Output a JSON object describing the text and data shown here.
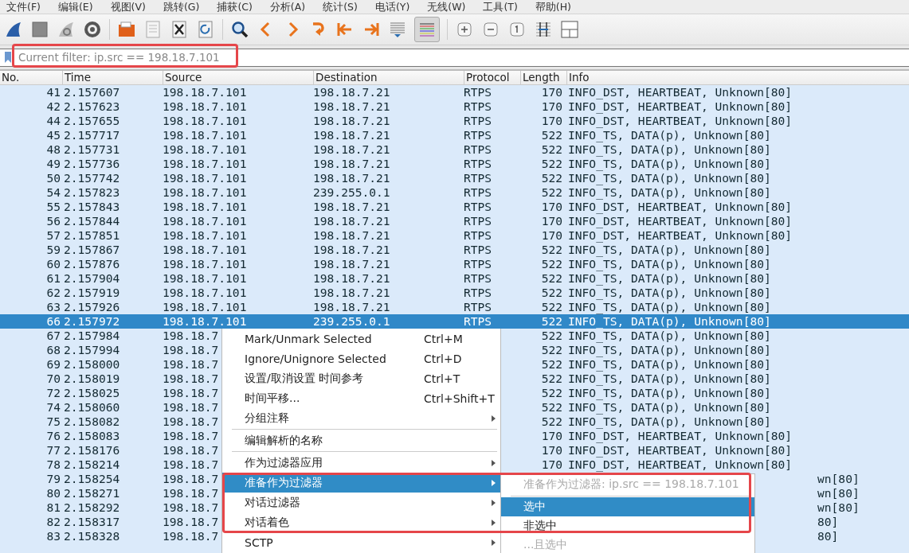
{
  "menubar": [
    "文件(F)",
    "编辑(E)",
    "视图(V)",
    "跳转(G)",
    "捕获(C)",
    "分析(A)",
    "统计(S)",
    "电话(Y)",
    "无线(W)",
    "工具(T)",
    "帮助(H)"
  ],
  "toolbar": {
    "colorize_pressed": true
  },
  "filter": {
    "placeholder": "Current filter: ip.src == 198.18.7.101"
  },
  "table": {
    "columns": [
      "No.",
      "Time",
      "Source",
      "Destination",
      "Protocol",
      "Length",
      "Info"
    ],
    "rows": [
      {
        "no": "41",
        "time": "2.157607",
        "source": "198.18.7.101",
        "destination": "198.18.7.21",
        "protocol": "RTPS",
        "length": "170",
        "info": "INFO_DST, HEARTBEAT, Unknown[80]",
        "selected": false
      },
      {
        "no": "42",
        "time": "2.157623",
        "source": "198.18.7.101",
        "destination": "198.18.7.21",
        "protocol": "RTPS",
        "length": "170",
        "info": "INFO_DST, HEARTBEAT, Unknown[80]",
        "selected": false
      },
      {
        "no": "44",
        "time": "2.157655",
        "source": "198.18.7.101",
        "destination": "198.18.7.21",
        "protocol": "RTPS",
        "length": "170",
        "info": "INFO_DST, HEARTBEAT, Unknown[80]",
        "selected": false
      },
      {
        "no": "45",
        "time": "2.157717",
        "source": "198.18.7.101",
        "destination": "198.18.7.21",
        "protocol": "RTPS",
        "length": "522",
        "info": "INFO_TS, DATA(p), Unknown[80]",
        "selected": false
      },
      {
        "no": "48",
        "time": "2.157731",
        "source": "198.18.7.101",
        "destination": "198.18.7.21",
        "protocol": "RTPS",
        "length": "522",
        "info": "INFO_TS, DATA(p), Unknown[80]",
        "selected": false
      },
      {
        "no": "49",
        "time": "2.157736",
        "source": "198.18.7.101",
        "destination": "198.18.7.21",
        "protocol": "RTPS",
        "length": "522",
        "info": "INFO_TS, DATA(p), Unknown[80]",
        "selected": false
      },
      {
        "no": "50",
        "time": "2.157742",
        "source": "198.18.7.101",
        "destination": "198.18.7.21",
        "protocol": "RTPS",
        "length": "522",
        "info": "INFO_TS, DATA(p), Unknown[80]",
        "selected": false
      },
      {
        "no": "54",
        "time": "2.157823",
        "source": "198.18.7.101",
        "destination": "239.255.0.1",
        "protocol": "RTPS",
        "length": "522",
        "info": "INFO_TS, DATA(p), Unknown[80]",
        "selected": false
      },
      {
        "no": "55",
        "time": "2.157843",
        "source": "198.18.7.101",
        "destination": "198.18.7.21",
        "protocol": "RTPS",
        "length": "170",
        "info": "INFO_DST, HEARTBEAT, Unknown[80]",
        "selected": false
      },
      {
        "no": "56",
        "time": "2.157844",
        "source": "198.18.7.101",
        "destination": "198.18.7.21",
        "protocol": "RTPS",
        "length": "170",
        "info": "INFO_DST, HEARTBEAT, Unknown[80]",
        "selected": false
      },
      {
        "no": "57",
        "time": "2.157851",
        "source": "198.18.7.101",
        "destination": "198.18.7.21",
        "protocol": "RTPS",
        "length": "170",
        "info": "INFO_DST, HEARTBEAT, Unknown[80]",
        "selected": false
      },
      {
        "no": "59",
        "time": "2.157867",
        "source": "198.18.7.101",
        "destination": "198.18.7.21",
        "protocol": "RTPS",
        "length": "522",
        "info": "INFO_TS, DATA(p), Unknown[80]",
        "selected": false
      },
      {
        "no": "60",
        "time": "2.157876",
        "source": "198.18.7.101",
        "destination": "198.18.7.21",
        "protocol": "RTPS",
        "length": "522",
        "info": "INFO_TS, DATA(p), Unknown[80]",
        "selected": false
      },
      {
        "no": "61",
        "time": "2.157904",
        "source": "198.18.7.101",
        "destination": "198.18.7.21",
        "protocol": "RTPS",
        "length": "522",
        "info": "INFO_TS, DATA(p), Unknown[80]",
        "selected": false
      },
      {
        "no": "62",
        "time": "2.157919",
        "source": "198.18.7.101",
        "destination": "198.18.7.21",
        "protocol": "RTPS",
        "length": "522",
        "info": "INFO_TS, DATA(p), Unknown[80]",
        "selected": false
      },
      {
        "no": "63",
        "time": "2.157926",
        "source": "198.18.7.101",
        "destination": "198.18.7.21",
        "protocol": "RTPS",
        "length": "522",
        "info": "INFO_TS, DATA(p), Unknown[80]",
        "selected": false
      },
      {
        "no": "66",
        "time": "2.157972",
        "source": "198.18.7.101",
        "destination": "239.255.0.1",
        "protocol": "RTPS",
        "length": "522",
        "info": "INFO_TS, DATA(p), Unknown[80]",
        "selected": true
      },
      {
        "no": "67",
        "time": "2.157984",
        "source": "198.18.7",
        "length": "522",
        "info": "INFO_TS, DATA(p), Unknown[80]",
        "selected": false
      },
      {
        "no": "68",
        "time": "2.157994",
        "source": "198.18.7",
        "length": "522",
        "info": "INFO_TS, DATA(p), Unknown[80]",
        "selected": false
      },
      {
        "no": "69",
        "time": "2.158000",
        "source": "198.18.7",
        "length": "522",
        "info": "INFO_TS, DATA(p), Unknown[80]",
        "selected": false
      },
      {
        "no": "70",
        "time": "2.158019",
        "source": "198.18.7",
        "length": "522",
        "info": "INFO_TS, DATA(p), Unknown[80]",
        "selected": false
      },
      {
        "no": "72",
        "time": "2.158025",
        "source": "198.18.7",
        "length": "522",
        "info": "INFO_TS, DATA(p), Unknown[80]",
        "selected": false
      },
      {
        "no": "74",
        "time": "2.158060",
        "source": "198.18.7",
        "length": "522",
        "info": "INFO_TS, DATA(p), Unknown[80]",
        "selected": false
      },
      {
        "no": "75",
        "time": "2.158082",
        "source": "198.18.7",
        "length": "522",
        "info": "INFO_TS, DATA(p), Unknown[80]",
        "selected": false
      },
      {
        "no": "76",
        "time": "2.158083",
        "source": "198.18.7",
        "length": "170",
        "info": "INFO_DST, HEARTBEAT, Unknown[80]",
        "selected": false
      },
      {
        "no": "77",
        "time": "2.158176",
        "source": "198.18.7",
        "length": "170",
        "info": "INFO_DST, HEARTBEAT, Unknown[80]",
        "selected": false
      },
      {
        "no": "78",
        "time": "2.158214",
        "source": "198.18.7",
        "length": "170",
        "info": "INFO_DST, HEARTBEAT, Unknown[80]",
        "selected": false
      },
      {
        "no": "79",
        "time": "2.158254",
        "source": "198.18.7",
        "info_tail": "wn[80]",
        "selected": false
      },
      {
        "no": "80",
        "time": "2.158271",
        "source": "198.18.7",
        "info_tail": "wn[80]",
        "selected": false
      },
      {
        "no": "81",
        "time": "2.158292",
        "source": "198.18.7",
        "info_tail": "wn[80]",
        "selected": false
      },
      {
        "no": "82",
        "time": "2.158317",
        "source": "198.18.7",
        "info_tail": "80]",
        "selected": false
      },
      {
        "no": "83",
        "time": "2.158328",
        "source": "198.18.7",
        "info_tail": "80]",
        "selected": false
      }
    ]
  },
  "context_menu": {
    "items": [
      {
        "kind": "item",
        "label": "Mark/Unmark Selected",
        "shortcut": "Ctrl+M",
        "submenu": false,
        "selected": false
      },
      {
        "kind": "item",
        "label": "Ignore/Unignore Selected",
        "shortcut": "Ctrl+D",
        "submenu": false,
        "selected": false
      },
      {
        "kind": "item",
        "label": "设置/取消设置 时间参考",
        "shortcut": "Ctrl+T",
        "submenu": false,
        "selected": false
      },
      {
        "kind": "item",
        "label": "时间平移...",
        "shortcut": "Ctrl+Shift+T",
        "submenu": false,
        "selected": false
      },
      {
        "kind": "item",
        "label": "分组注释",
        "submenu": true,
        "selected": false
      },
      {
        "kind": "separator"
      },
      {
        "kind": "item",
        "label": "编辑解析的名称",
        "submenu": false,
        "selected": false
      },
      {
        "kind": "separator"
      },
      {
        "kind": "item",
        "label": "作为过滤器应用",
        "submenu": true,
        "selected": false
      },
      {
        "kind": "item",
        "label": "准备作为过滤器",
        "submenu": true,
        "selected": true
      },
      {
        "kind": "item",
        "label": "对话过滤器",
        "submenu": true,
        "selected": false
      },
      {
        "kind": "item",
        "label": "对话着色",
        "submenu": true,
        "selected": false
      },
      {
        "kind": "item",
        "label": "SCTP",
        "submenu": true,
        "selected": false
      }
    ]
  },
  "submenu": {
    "items": [
      {
        "kind": "header",
        "label": "准备作为过滤器: ip.src == 198.18.7.101",
        "disabled": true,
        "selected": false
      },
      {
        "kind": "separator"
      },
      {
        "kind": "item",
        "label": "选中",
        "disabled": false,
        "selected": true
      },
      {
        "kind": "item",
        "label": "非选中",
        "disabled": false,
        "selected": false
      },
      {
        "kind": "item",
        "label": "...且选中",
        "disabled": true,
        "selected": false
      }
    ]
  }
}
